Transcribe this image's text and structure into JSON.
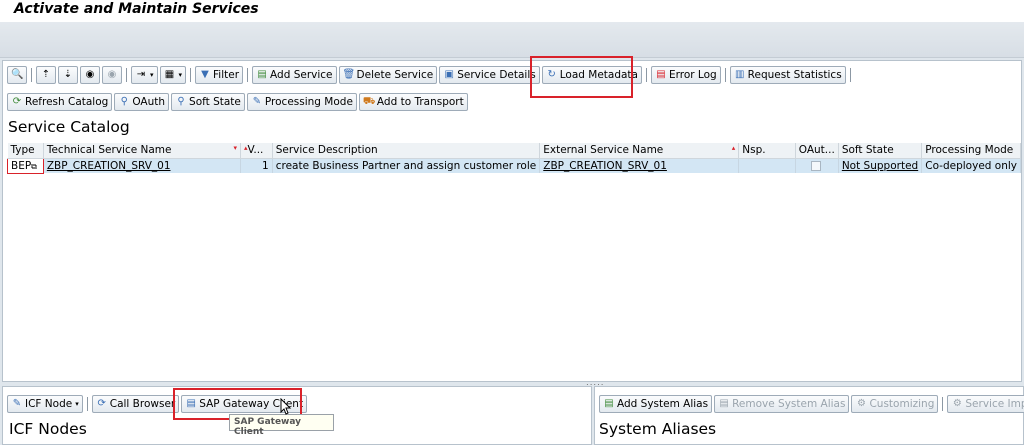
{
  "window": {
    "title": "Activate and Maintain Services"
  },
  "toolbar_main": {
    "filter": "Filter",
    "add_service": "Add Service",
    "delete_service": "Delete Service",
    "service_details": "Service Details",
    "load_metadata": "Load Metadata",
    "error_log": "Error Log",
    "request_statistics": "Request Statistics"
  },
  "toolbar_secondary": {
    "refresh_catalog": "Refresh Catalog",
    "oauth": "OAuth",
    "soft_state": "Soft State",
    "processing_mode": "Processing Mode",
    "add_to_transport": "Add to Transport"
  },
  "catalog": {
    "title": "Service Catalog",
    "columns": {
      "type": "Type",
      "technical_name": "Technical Service Name",
      "version": "V...",
      "description": "Service Description",
      "external_name": "External Service Name",
      "namespace": "Nsp.",
      "oauth": "OAut...",
      "soft_state": "Soft State",
      "processing_mode": "Processing Mode"
    },
    "rows": [
      {
        "type": "BEP",
        "technical_name": "ZBP_CREATION_SRV_01",
        "version": "1",
        "description": "create Business Partner and assign customer role",
        "external_name": "ZBP_CREATION_SRV_01",
        "namespace": "",
        "soft_state": "Not Supported",
        "processing_mode": "Co-deployed only"
      }
    ]
  },
  "icf_panel": {
    "icf_node": "ICF Node",
    "call_browser": "Call Browser",
    "gateway_client": "SAP Gateway Client",
    "title": "ICF Nodes"
  },
  "tooltip": {
    "text": "SAP Gateway Client"
  },
  "alias_panel": {
    "add_alias": "Add System Alias",
    "remove_alias": "Remove System Alias",
    "customizing": "Customizing",
    "service_impl": "Service Implemen",
    "title": "System Aliases"
  },
  "colors": {
    "selected_row": "#d3e6f4",
    "highlight": "#d9222a",
    "panel_background": "#dfe6ec"
  }
}
